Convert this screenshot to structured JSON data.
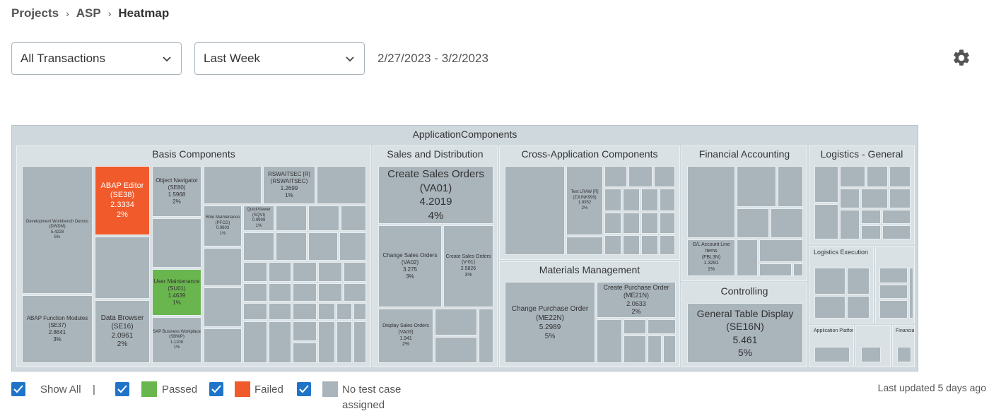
{
  "breadcrumb": {
    "items": [
      "Projects",
      "ASP"
    ],
    "current": "Heatmap"
  },
  "filters": {
    "transaction": "All Transactions",
    "period": "Last Week",
    "date_range": "2/27/2023 - 3/2/2023"
  },
  "treemap": {
    "root_title": "ApplicationComponents",
    "groups": {
      "basis": "Basis Components",
      "sd": "Sales and Distribution",
      "ca": "Cross-Application Components",
      "fa": "Financial Accounting",
      "lg": "Logistics - General",
      "mm": "Materials Management",
      "co": "Controlling",
      "le": "Logistics Execution",
      "ap": "Application Platform",
      "fin": "Financials"
    },
    "cells": {
      "dwdm": [
        "Development Workbench Demos",
        "(DWDM)",
        "5.4228",
        "5%"
      ],
      "se38": [
        "ABAP Editor",
        "(SE38)",
        "2.3334",
        "2%"
      ],
      "se80": [
        "Object Navigator",
        "(SE80)",
        "1.5968",
        "2%"
      ],
      "rswait": [
        "RSWAITSEC [R]",
        "(RSWAITSEC)",
        "1.2699",
        "1%"
      ],
      "se37": [
        "ABAP Function Modules",
        "(SE37)",
        "2.8641",
        "3%"
      ],
      "su01": [
        "User Maintenance",
        "(SU01)",
        "1.4639",
        "1%"
      ],
      "se16": [
        "Data Browser",
        "(SE16)",
        "2.0961",
        "2%"
      ],
      "va01": [
        "Create Sales Orders",
        "(VA01)",
        "4.2019",
        "4%"
      ],
      "va02": [
        "Change Sales Orders",
        "(VA02)",
        "3.275",
        "3%"
      ],
      "v01": [
        "Create Sales Orders",
        "(V-01)",
        "2.5826",
        "3%"
      ],
      "va03": [
        "Display Sales Orders",
        "(VA03)",
        "1.941",
        "2%"
      ],
      "zjunk": [
        "Test LRAW [R]",
        "(ZJUNK999)",
        "1.8352",
        "2%"
      ],
      "me22n": [
        "Change Purchase Order",
        "(ME22N)",
        "5.2989",
        "5%"
      ],
      "me21n": [
        "Create Purchase Order",
        "(ME21N)",
        "2.0633",
        "2%"
      ],
      "se16n": [
        "General Table Display",
        "(SE16N)",
        "5.461",
        "5%"
      ],
      "fbl3n": [
        "G/L Account Line Items",
        "(FBL3N)",
        "1.3281",
        "1%"
      ],
      "qv": [
        "QuickViewer",
        "(SQVI)",
        "0.9999",
        "1%"
      ],
      "rolemaint": [
        "Role Maintenance",
        "(PFCG)",
        "0.9803",
        "1%"
      ],
      "sbwp": [
        "SAP Business Workplace",
        "(SBWP)",
        "1.1108",
        "1%"
      ]
    }
  },
  "legend": {
    "show_all": "Show All",
    "passed": "Passed",
    "failed": "Failed",
    "no_test": "No test case assigned",
    "separator": "|"
  },
  "colors": {
    "failed": "#f15a2b",
    "passed": "#6ab64e",
    "no_test": "#a9b4bb",
    "checkbox": "#1f74c8"
  },
  "last_updated": "Last updated 5 days ago"
}
